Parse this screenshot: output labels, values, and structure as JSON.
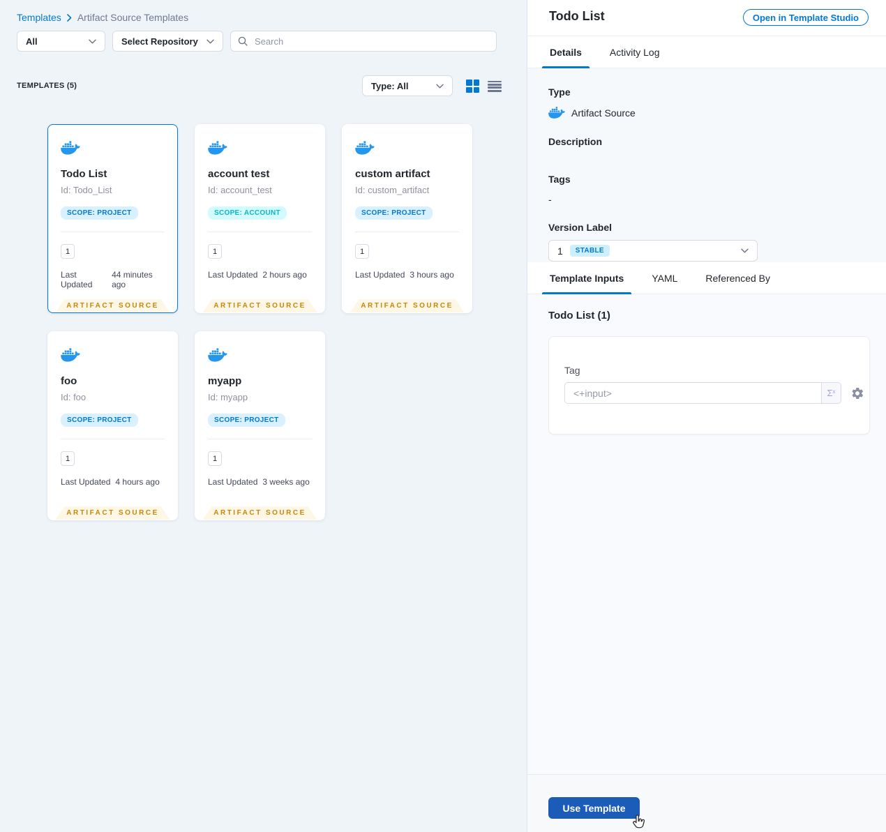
{
  "colors": {
    "accent": "#0278D5",
    "docker_blue": "#2496ED",
    "scope_project_text": "#0278D5",
    "scope_project_bg": "#D9F1FE",
    "scope_account_text": "#06B7C8",
    "scope_account_bg": "#D3FBFD",
    "ribbon_text": "#C8860A",
    "ribbon_bg": "#FEF7E6",
    "stable_text": "#0278D5",
    "stable_bg": "#CDEFFE",
    "use_template_bg": "#1A5CB8",
    "left_background": "#EFF4F9"
  },
  "breadcrumb": {
    "root": "Templates",
    "current": "Artifact Source Templates"
  },
  "filters": {
    "scope_value": "All",
    "repository_value": "Select Repository",
    "search_placeholder": "Search"
  },
  "list_header": {
    "count_label": "TEMPLATES (5)",
    "type_filter": "Type: All"
  },
  "card_common": {
    "version_count": "1",
    "last_updated_label": "Last Updated",
    "ribbon": "ARTIFACT SOURCE"
  },
  "cards": [
    {
      "title": "Todo List",
      "id": "Id: Todo_List",
      "scope": "SCOPE: PROJECT",
      "updated": "44 minutes ago"
    },
    {
      "title": "account test",
      "id": "Id: account_test",
      "scope": "SCOPE: ACCOUNT",
      "updated": "2 hours ago"
    },
    {
      "title": "custom artifact",
      "id": "Id: custom_artifact",
      "scope": "SCOPE: PROJECT",
      "updated": "3 hours ago"
    },
    {
      "title": "foo",
      "id": "Id: foo",
      "scope": "SCOPE: PROJECT",
      "updated": "4 hours ago"
    },
    {
      "title": "myapp",
      "id": "Id: myapp",
      "scope": "SCOPE: PROJECT",
      "updated": "3 weeks ago"
    }
  ],
  "panel": {
    "title": "Todo List",
    "open_button": "Open in Template Studio",
    "tabs": {
      "details": "Details",
      "activity_log": "Activity Log"
    },
    "details": {
      "type_label": "Type",
      "type_value": "Artifact Source",
      "description_label": "Description",
      "tags_label": "Tags",
      "tags_value": "-",
      "version_label": "Version Label",
      "version_value": "1",
      "version_badge": "STABLE"
    },
    "sub_tabs": {
      "template_inputs": "Template Inputs",
      "yaml": "YAML",
      "referenced_by": "Referenced By"
    },
    "inputs": {
      "heading": "Todo List (1)",
      "tag_label": "Tag",
      "tag_placeholder": "<+input>",
      "sigma": "Σ",
      "sigma_sup": "x"
    },
    "footer": {
      "use_template": "Use Template"
    }
  }
}
